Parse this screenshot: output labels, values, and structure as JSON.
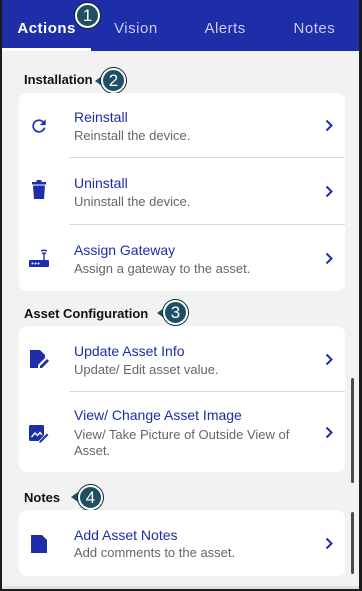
{
  "tabs": [
    {
      "label": "Actions",
      "active": true
    },
    {
      "label": "Vision",
      "active": false
    },
    {
      "label": "Alerts",
      "active": false
    },
    {
      "label": "Notes",
      "active": false
    }
  ],
  "callouts": [
    "1",
    "2",
    "3",
    "4"
  ],
  "sections": {
    "installation": {
      "title": "Installation",
      "items": [
        {
          "title": "Reinstall",
          "desc": "Reinstall the device.",
          "icon": "refresh-icon"
        },
        {
          "title": "Uninstall",
          "desc": "Uninstall the device.",
          "icon": "trash-icon"
        },
        {
          "title": "Assign Gateway",
          "desc": "Assign a gateway to the asset.",
          "icon": "router-icon"
        }
      ]
    },
    "asset_configuration": {
      "title": "Asset Configuration",
      "items": [
        {
          "title": "Update Asset Info",
          "desc": "Update/ Edit asset value.",
          "icon": "edit-document-icon"
        },
        {
          "title": "View/ Change Asset Image",
          "desc": "View/ Take Picture of Outside View of Asset.",
          "icon": "edit-image-icon"
        }
      ]
    },
    "notes": {
      "title": "Notes",
      "items": [
        {
          "title": "Add Asset Notes",
          "desc": "Add comments to the asset.",
          "icon": "note-icon"
        }
      ]
    }
  },
  "colors": {
    "brand": "#1d2ea8",
    "callout": "#1f4f63",
    "background": "#f2f2f2"
  }
}
